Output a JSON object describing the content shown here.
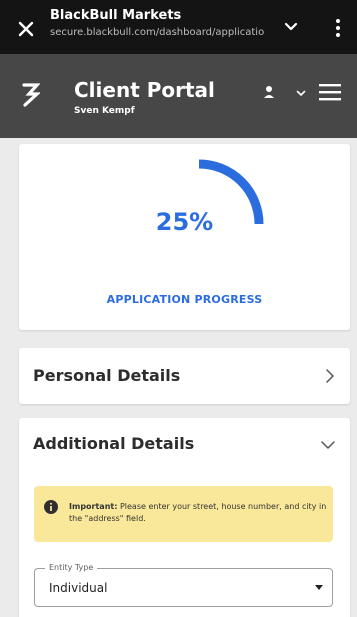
{
  "browser": {
    "site_title": "BlackBull Markets",
    "url": "secure.blackbull.com/dashboard/applicatio"
  },
  "header": {
    "app_title": "Client Portal",
    "user_name": "Sven Kempf"
  },
  "progress": {
    "value": 25,
    "percent_text": "25%",
    "label": "APPLICATION PROGRESS"
  },
  "sections": {
    "personal": {
      "title": "Personal Details"
    },
    "additional": {
      "title": "Additional Details"
    }
  },
  "notice": {
    "strong": "Important:",
    "text": " Please enter your street, house number, and city in the \"address\" field."
  },
  "entity_type": {
    "label": "Entity Type",
    "value": "Individual"
  },
  "colors": {
    "accent": "#2b6ddf",
    "notice_bg": "#fae89a",
    "header_bg": "#474747",
    "topbar_bg": "#141414"
  },
  "icons": [
    "close-icon",
    "chevron-down-icon",
    "more-vert-icon",
    "logo-icon",
    "person-icon",
    "menu-icon",
    "chevron-right-icon",
    "info-icon",
    "dropdown-caret-icon"
  ]
}
